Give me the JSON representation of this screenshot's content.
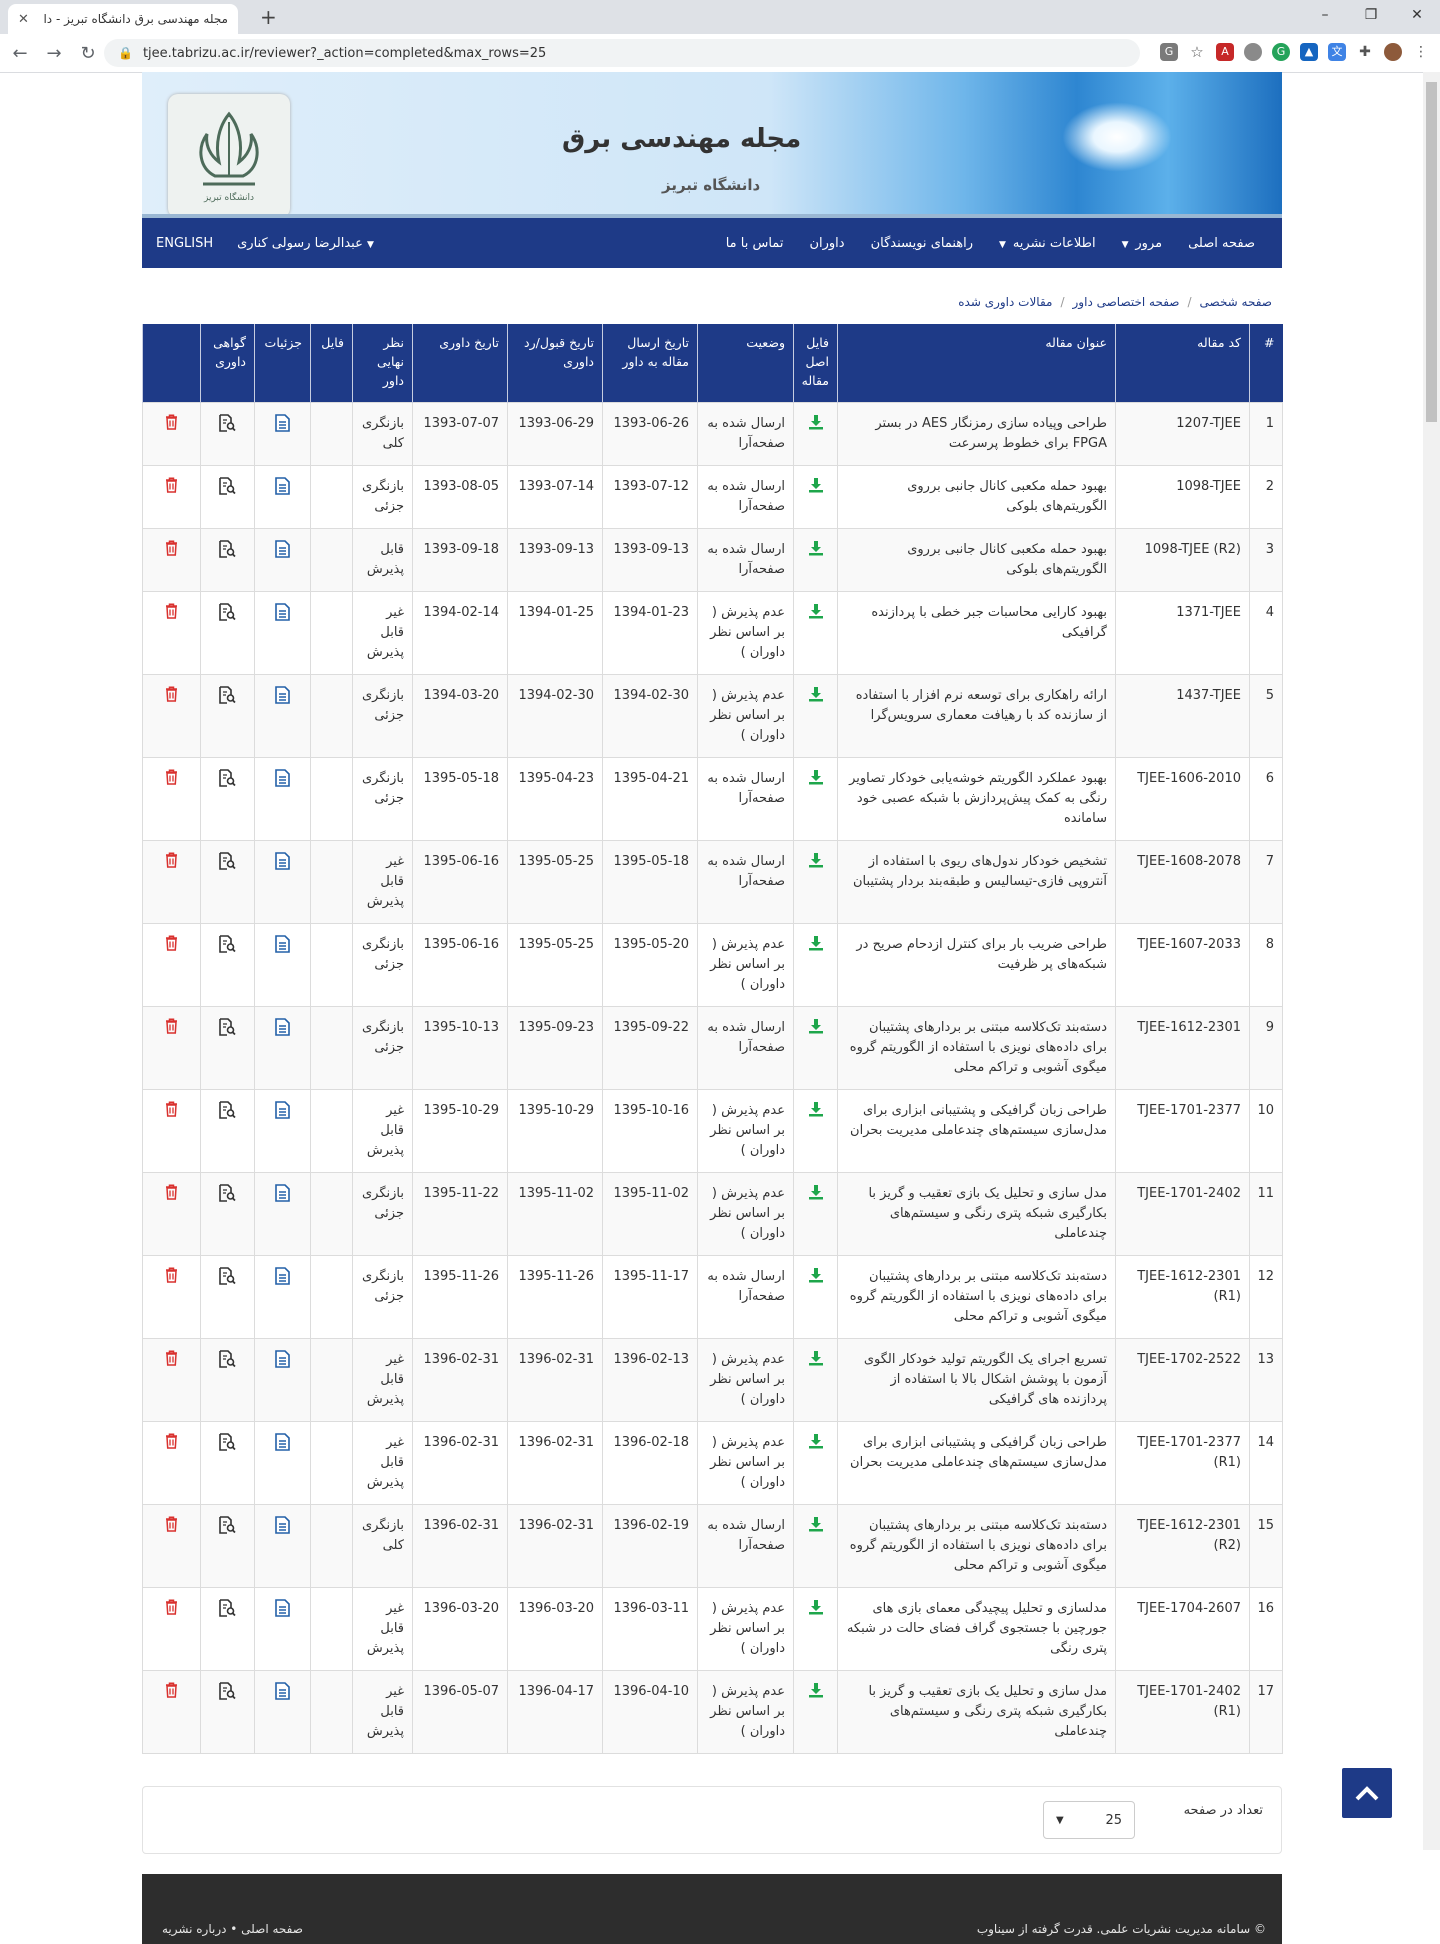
{
  "browser": {
    "tab_title": "مجله مهندسی برق دانشگاه تبریز - دا",
    "url": "tjee.tabrizu.ac.ir/reviewer?_action=completed&max_rows=25"
  },
  "banner": {
    "title": "مجله مهندسی برق",
    "subtitle": "دانشگاه تبریز",
    "logo_text": "دانشگاه تبریز"
  },
  "nav": {
    "items": [
      {
        "label": "صفحه اصلی",
        "dropdown": false
      },
      {
        "label": "مرور",
        "dropdown": true
      },
      {
        "label": "اطلاعات نشریه",
        "dropdown": true
      },
      {
        "label": "راهنمای نویسندگان",
        "dropdown": false
      },
      {
        "label": "داوران",
        "dropdown": false
      },
      {
        "label": "تماس با ما",
        "dropdown": false
      }
    ],
    "user": "عبدالرضا رسولی کناری",
    "english": "ENGLISH"
  },
  "breadcrumb": [
    "صفحه شخصی",
    "صفحه اختصاصی داور",
    "مقالات داوری شده"
  ],
  "table": {
    "headers": {
      "num": "#",
      "code": "کد مقاله",
      "title": "عنوان مقاله",
      "file": "فایل اصل مقاله",
      "status": "وضعیت",
      "sent": "تاریخ ارسال مقاله به داور",
      "accept": "تاریخ قبول/رد داوری",
      "review": "تاریخ داوری",
      "opinion": "نظر نهایی داور",
      "attach": "فایل",
      "details": "جزئیات",
      "cert": "گواهی داوری"
    },
    "rows": [
      {
        "num": "1",
        "code": "1207-TJEE",
        "title": "طراحی وپیاده سازی رمزنگار AES در بستر FPGA برای خطوط پرسرعت",
        "status": "ارسال شده به صفحه‌آرا",
        "sent": "1393-06-26",
        "accept": "1393-06-29",
        "review": "1393-07-07",
        "opinion": "بازنگری کلی"
      },
      {
        "num": "2",
        "code": "1098-TJEE",
        "title": "بهبود حمله مکعبی کانال جانبی برروی الگوریتم‌های بلوکی",
        "status": "ارسال شده به صفحه‌آرا",
        "sent": "1393-07-12",
        "accept": "1393-07-14",
        "review": "1393-08-05",
        "opinion": "بازنگری جزئی"
      },
      {
        "num": "3",
        "code": "1098-TJEE (R2)",
        "title": "بهبود حمله مکعبی کانال جانبی برروی الگوریتم‌های بلوکی",
        "status": "ارسال شده به صفحه‌آرا",
        "sent": "1393-09-13",
        "accept": "1393-09-13",
        "review": "1393-09-18",
        "opinion": "قابل پذیرش"
      },
      {
        "num": "4",
        "code": "1371-TJEE",
        "title": "بهبود کارایی محاسبات جبر خطی با پردازنده گرافیکی",
        "status": "عدم پذیرش ( بر اساس نظر داوران )",
        "sent": "1394-01-23",
        "accept": "1394-01-25",
        "review": "1394-02-14",
        "opinion": "غیر قابل پذیرش"
      },
      {
        "num": "5",
        "code": "1437-TJEE",
        "title": "ارائه راهکاری برای توسعه نرم افزار با استفاده از سازنده کد با رهیافت معماری سرویس‌گرا",
        "status": "عدم پذیرش ( بر اساس نظر داوران )",
        "sent": "1394-02-30",
        "accept": "1394-02-30",
        "review": "1394-03-20",
        "opinion": "بازنگری جزئی"
      },
      {
        "num": "6",
        "code": "TJEE-1606-2010",
        "title": "بهبود عملکرد الگوریتم خوشه‌یابی خودکار تصاویر رنگی به کمک پیش‌پردازش با شبکه عصبی خود سامانده",
        "status": "ارسال شده به صفحه‌آرا",
        "sent": "1395-04-21",
        "accept": "1395-04-23",
        "review": "1395-05-18",
        "opinion": "بازنگری جزئی"
      },
      {
        "num": "7",
        "code": "TJEE-1608-2078",
        "title": "تشخیص خودکار ندول‌های ریوی با استفاده از آنتروپی فازی-تیسالیس و طبقه‌بند بردار پشتیبان",
        "status": "ارسال شده به صفحه‌آرا",
        "sent": "1395-05-18",
        "accept": "1395-05-25",
        "review": "1395-06-16",
        "opinion": "غیر قابل پذیرش"
      },
      {
        "num": "8",
        "code": "TJEE-1607-2033",
        "title": "طراحی ضریب بار برای کنترل ازدحام صریح در شبکه‌های پر ظرفیت",
        "status": "عدم پذیرش ( بر اساس نظر داوران )",
        "sent": "1395-05-20",
        "accept": "1395-05-25",
        "review": "1395-06-16",
        "opinion": "بازنگری جزئی"
      },
      {
        "num": "9",
        "code": "TJEE-1612-2301",
        "title": "دسته‌بند تک‌کلاسه مبتنی بر بردارهای پشتیبان برای داده‌های نویزی با استفاده از الگوریتم گروه میگوی آشوبی و تراکم محلی",
        "status": "ارسال شده به صفحه‌آرا",
        "sent": "1395-09-22",
        "accept": "1395-09-23",
        "review": "1395-10-13",
        "opinion": "بازنگری جزئی"
      },
      {
        "num": "10",
        "code": "TJEE-1701-2377",
        "title": "طراحی زبان گرافیکی و پشتیبانی ابزاری برای مدل‌سازی سیستم‌های چندعاملی مدیریت بحران",
        "status": "عدم پذیرش ( بر اساس نظر داوران )",
        "sent": "1395-10-16",
        "accept": "1395-10-29",
        "review": "1395-10-29",
        "opinion": "غیر قابل پذیرش"
      },
      {
        "num": "11",
        "code": "TJEE-1701-2402",
        "title": "مدل سازی و تحلیل یک بازی تعقیب و گریز با بکارگیری شبکه پتری رنگی و سیستم‌های چندعاملی",
        "status": "عدم پذیرش ( بر اساس نظر داوران )",
        "sent": "1395-11-02",
        "accept": "1395-11-02",
        "review": "1395-11-22",
        "opinion": "بازنگری جزئی"
      },
      {
        "num": "12",
        "code": "TJEE-1612-2301 (R1)",
        "title": "دسته‌بند تک‌کلاسه مبتنی بر بردارهای پشتیبان برای داده‌های نویزی با استفاده از الگوریتم گروه میگوی آشوبی و تراکم محلی",
        "status": "ارسال شده به صفحه‌آرا",
        "sent": "1395-11-17",
        "accept": "1395-11-26",
        "review": "1395-11-26",
        "opinion": "بازنگری جزئی"
      },
      {
        "num": "13",
        "code": "TJEE-1702-2522",
        "title": "تسریع اجرای یک الگوریتم تولید خودکار الگوی آزمون با پوشش اشکال بالا با استفاده از پردازنده های گرافیکی",
        "status": "عدم پذیرش ( بر اساس نظر داوران )",
        "sent": "1396-02-13",
        "accept": "1396-02-31",
        "review": "1396-02-31",
        "opinion": "غیر قابل پذیرش"
      },
      {
        "num": "14",
        "code": "TJEE-1701-2377 (R1)",
        "title": "طراحی زبان گرافیکی و پشتیبانی ابزاری برای مدل‌سازی سیستم‌های چندعاملی مدیریت بحران",
        "status": "عدم پذیرش ( بر اساس نظر داوران )",
        "sent": "1396-02-18",
        "accept": "1396-02-31",
        "review": "1396-02-31",
        "opinion": "غیر قابل پذیرش"
      },
      {
        "num": "15",
        "code": "TJEE-1612-2301 (R2)",
        "title": "دسته‌بند تک‌کلاسه مبتنی بر بردارهای پشتیبان برای داده‌های نویزی با استفاده از الگوریتم گروه میگوی آشوبی و تراکم محلی",
        "status": "ارسال شده به صفحه‌آرا",
        "sent": "1396-02-19",
        "accept": "1396-02-31",
        "review": "1396-02-31",
        "opinion": "بازنگری کلی"
      },
      {
        "num": "16",
        "code": "TJEE-1704-2607",
        "title": "مدلسازی و تحلیل پیچیدگی معمای بازی های جورچین با جستجوی گراف فضای حالت در شبکه پتری رنگی",
        "status": "عدم پذیرش ( بر اساس نظر داوران )",
        "sent": "1396-03-11",
        "accept": "1396-03-20",
        "review": "1396-03-20",
        "opinion": "غیر قابل پذیرش"
      },
      {
        "num": "17",
        "code": "TJEE-1701-2402 (R1)",
        "title": "مدل سازی و تحلیل یک بازی تعقیب و گریز با بکارگیری شبکه پتری رنگی و سیستم‌های چندعاملی",
        "status": "عدم پذیرش ( بر اساس نظر داوران )",
        "sent": "1396-04-10",
        "accept": "1396-04-17",
        "review": "1396-05-07",
        "opinion": "غیر قابل پذیرش"
      }
    ]
  },
  "pagination": {
    "label": "تعداد در صفحه",
    "value": "25"
  },
  "footer": {
    "copyright": "© سامانه مدیریت نشریات علمی. قدرت گرفته از سیناوب",
    "links": "صفحه اصلی • درباره نشریه"
  },
  "colors": {
    "nav_bg": "#1e3a87",
    "download_green": "#1ea64b",
    "delete_red": "#d9312e",
    "footer_bg": "#2d2d2d"
  },
  "icons": {
    "file": "download-icon",
    "details": "document-icon",
    "cert": "certificate-search-icon",
    "delete": "trash-icon"
  }
}
